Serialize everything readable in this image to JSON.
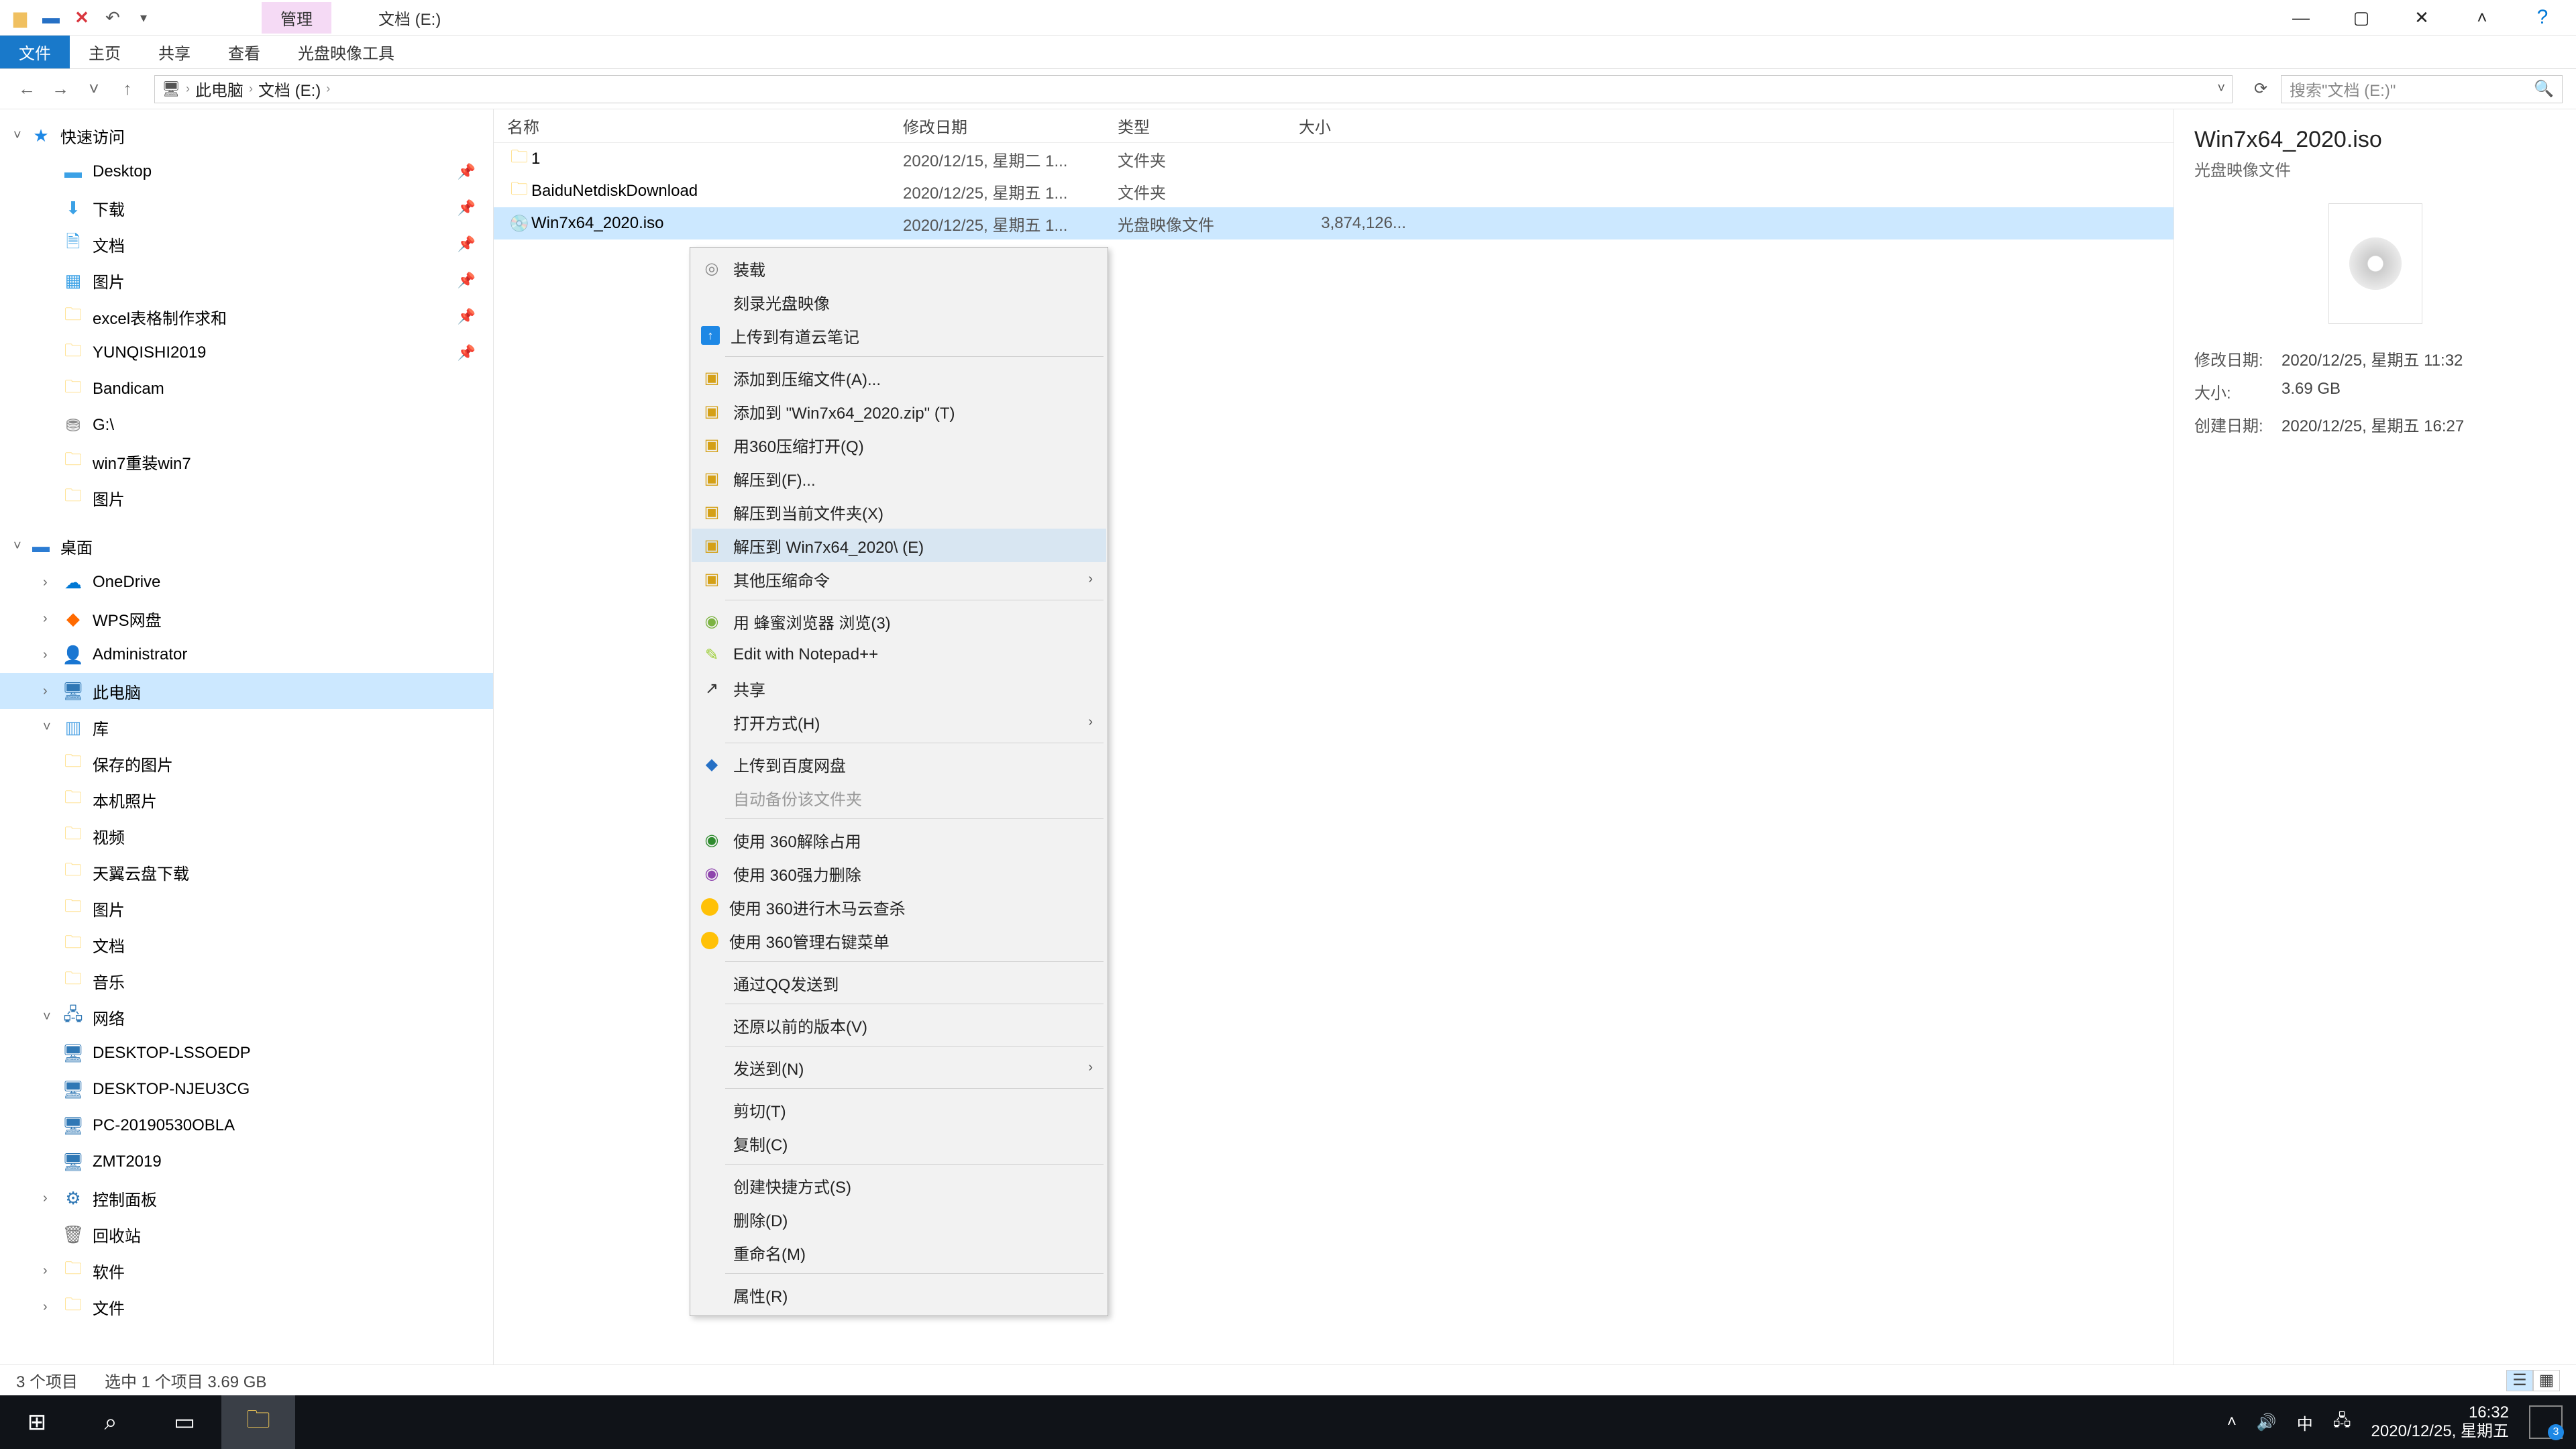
{
  "window": {
    "mgmt_tab": "管理",
    "title": "文档 (E:)",
    "qat": {
      "dropdown": "▾"
    }
  },
  "ribbon": {
    "file": "文件",
    "home": "主页",
    "share": "共享",
    "view": "查看",
    "disc_tools": "光盘映像工具"
  },
  "nav": {
    "back": "←",
    "fwd": "→",
    "up": "↑",
    "crumbs": [
      "此电脑",
      "文档 (E:)"
    ],
    "search_placeholder": "搜索\"文档 (E:)\""
  },
  "tree": {
    "quick": "快速访问",
    "desktop": "Desktop",
    "downloads": "下载",
    "documents": "文档",
    "pictures": "图片",
    "excel": "excel表格制作求和",
    "yunqishi": "YUNQISHI2019",
    "bandicam": "Bandicam",
    "gdrive": "G:\\",
    "win7": "win7重装win7",
    "pictures2": "图片",
    "desktop2": "桌面",
    "onedrive": "OneDrive",
    "wps": "WPS网盘",
    "admin": "Administrator",
    "thispc": "此电脑",
    "libs": "库",
    "saved_pics": "保存的图片",
    "cam_roll": "本机照片",
    "videos": "视频",
    "tianyi": "天翼云盘下载",
    "libs_pics": "图片",
    "libs_docs": "文档",
    "libs_music": "音乐",
    "network": "网络",
    "net1": "DESKTOP-LSSOEDP",
    "net2": "DESKTOP-NJEU3CG",
    "net3": "PC-20190530OBLA",
    "net4": "ZMT2019",
    "cpanel": "控制面板",
    "recycle": "回收站",
    "software": "软件",
    "files": "文件"
  },
  "columns": {
    "name": "名称",
    "date": "修改日期",
    "type": "类型",
    "size": "大小"
  },
  "rows": [
    {
      "name": "1",
      "date": "2020/12/15, 星期二 1...",
      "type": "文件夹",
      "size": "",
      "icon": "folder"
    },
    {
      "name": "BaiduNetdiskDownload",
      "date": "2020/12/25, 星期五 1...",
      "type": "文件夹",
      "size": "",
      "icon": "folder"
    },
    {
      "name": "Win7x64_2020.iso",
      "date": "2020/12/25, 星期五 1...",
      "type": "光盘映像文件",
      "size": "3,874,126...",
      "icon": "iso",
      "selected": true
    }
  ],
  "ctx": {
    "mount": "装载",
    "burn": "刻录光盘映像",
    "youdao": "上传到有道云笔记",
    "addzip": "添加到压缩文件(A)...",
    "addzip2": "添加到 \"Win7x64_2020.zip\" (T)",
    "open360": "用360压缩打开(Q)",
    "extractto": "解压到(F)...",
    "extracthere": "解压到当前文件夹(X)",
    "extractname": "解压到 Win7x64_2020\\ (E)",
    "othercomp": "其他压缩命令",
    "bee": "用 蜂蜜浏览器 浏览(3)",
    "npp": "Edit with Notepad++",
    "share": "共享",
    "openwith": "打开方式(H)",
    "bdp": "上传到百度网盘",
    "autobackup": "自动备份该文件夹",
    "unlock360": "使用 360解除占用",
    "forcedel": "使用 360强力删除",
    "trojan": "使用 360进行木马云查杀",
    "manage360": "使用 360管理右键菜单",
    "qqsend": "通过QQ发送到",
    "restore": "还原以前的版本(V)",
    "sendto": "发送到(N)",
    "cut": "剪切(T)",
    "copy": "复制(C)",
    "shortcut": "创建快捷方式(S)",
    "delete": "删除(D)",
    "rename": "重命名(M)",
    "props": "属性(R)"
  },
  "details": {
    "filename": "Win7x64_2020.iso",
    "filetype": "光盘映像文件",
    "mod_label": "修改日期:",
    "mod": "2020/12/25, 星期五 11:32",
    "size_label": "大小:",
    "size": "3.69 GB",
    "created_label": "创建日期:",
    "created": "2020/12/25, 星期五 16:27"
  },
  "status": {
    "count": "3 个项目",
    "selected": "选中 1 个项目  3.69 GB"
  },
  "taskbar": {
    "ime": "中",
    "time": "16:32",
    "date": "2020/12/25, 星期五"
  }
}
